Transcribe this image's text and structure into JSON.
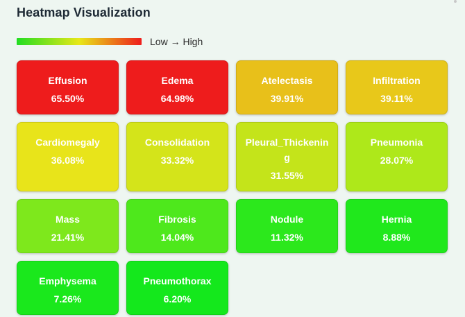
{
  "title": "Heatmap Visualization",
  "legend": {
    "label": "Low → High",
    "gradient_from": "#22dd22",
    "gradient_mid": "#e8e818",
    "gradient_to": "#ee1c1c"
  },
  "chart_data": {
    "type": "heatmap",
    "title": "Heatmap Visualization",
    "unit": "%",
    "cells": [
      {
        "name": "Effusion",
        "value": 65.5,
        "label": "65.50%",
        "color": "#ee1c1c"
      },
      {
        "name": "Edema",
        "value": 64.98,
        "label": "64.98%",
        "color": "#ee1c1c"
      },
      {
        "name": "Atelectasis",
        "value": 39.91,
        "label": "39.91%",
        "color": "#e8c01a"
      },
      {
        "name": "Infiltration",
        "value": 39.11,
        "label": "39.11%",
        "color": "#e8c81a"
      },
      {
        "name": "Cardiomegaly",
        "value": 36.08,
        "label": "36.08%",
        "color": "#e8e41a"
      },
      {
        "name": "Consolidation",
        "value": 33.32,
        "label": "33.32%",
        "color": "#d4e41a"
      },
      {
        "name": "Pleural_Thickening",
        "value": 31.55,
        "label": "31.55%",
        "color": "#c4e41a"
      },
      {
        "name": "Pneumonia",
        "value": 28.07,
        "label": "28.07%",
        "color": "#aee81a"
      },
      {
        "name": "Mass",
        "value": 21.41,
        "label": "21.41%",
        "color": "#7ee81c"
      },
      {
        "name": "Fibrosis",
        "value": 14.04,
        "label": "14.04%",
        "color": "#4ee81c"
      },
      {
        "name": "Nodule",
        "value": 11.32,
        "label": "11.32%",
        "color": "#2ce81c"
      },
      {
        "name": "Hernia",
        "value": 8.88,
        "label": "8.88%",
        "color": "#20e81c"
      },
      {
        "name": "Emphysema",
        "value": 7.26,
        "label": "7.26%",
        "color": "#1ae81c"
      },
      {
        "name": "Pneumothorax",
        "value": 6.2,
        "label": "6.20%",
        "color": "#14e81c"
      }
    ]
  }
}
